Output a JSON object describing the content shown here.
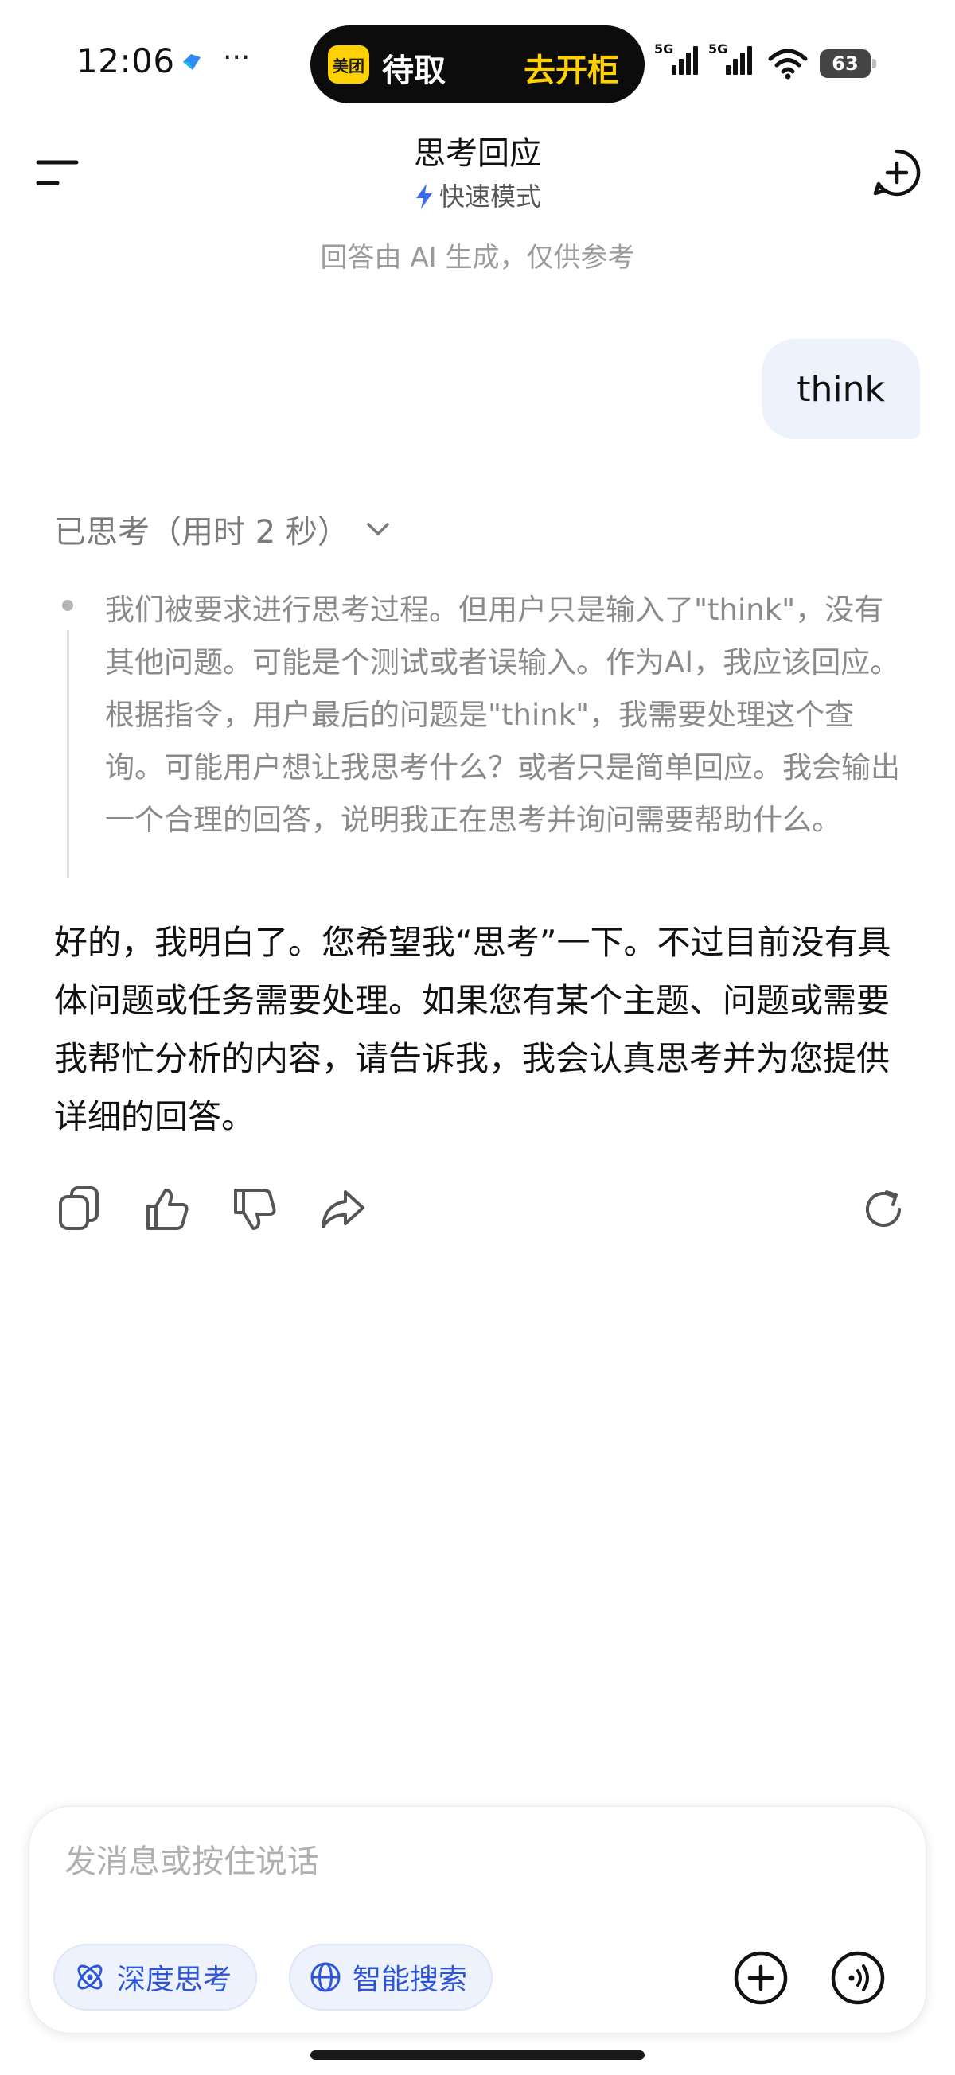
{
  "status_bar": {
    "time": "12:06",
    "more": "···",
    "island": {
      "app_logo": "美团",
      "left_text": "待取",
      "right_text": "去开柜"
    },
    "sim1_label": "5G",
    "sim2_label": "5G",
    "battery": "63"
  },
  "header": {
    "title": "思考回应",
    "mode_label": "快速模式",
    "disclaimer": "回答由 AI 生成，仅供参考"
  },
  "conversation": {
    "user_message": "think",
    "thinking_toggle": "已思考（用时 2 秒）",
    "thinking_text": "我们被要求进行思考过程。但用户只是输入了\"think\"，没有其他问题。可能是个测试或者误输入。作为AI，我应该回应。根据指令，用户最后的问题是\"think\"，我需要处理这个查询。可能用户想让我思考什么？或者只是简单回应。我会输出一个合理的回答，说明我正在思考并询问需要帮助什么。",
    "answer": "好的，我明白了。您希望我“思考”一下。不过目前没有具体问题或任务需要处理。如果您有某个主题、问题或需要我帮忙分析的内容，请告诉我，我会认真思考并为您提供详细的回答。"
  },
  "input": {
    "placeholder": "发消息或按住说话",
    "value": "",
    "chip_deep_think": "深度思考",
    "chip_smart_search": "智能搜索"
  },
  "colors": {
    "accent": "#2e55d8",
    "user_bubble": "#eef2fd",
    "muted_text": "#8a8a8a"
  }
}
